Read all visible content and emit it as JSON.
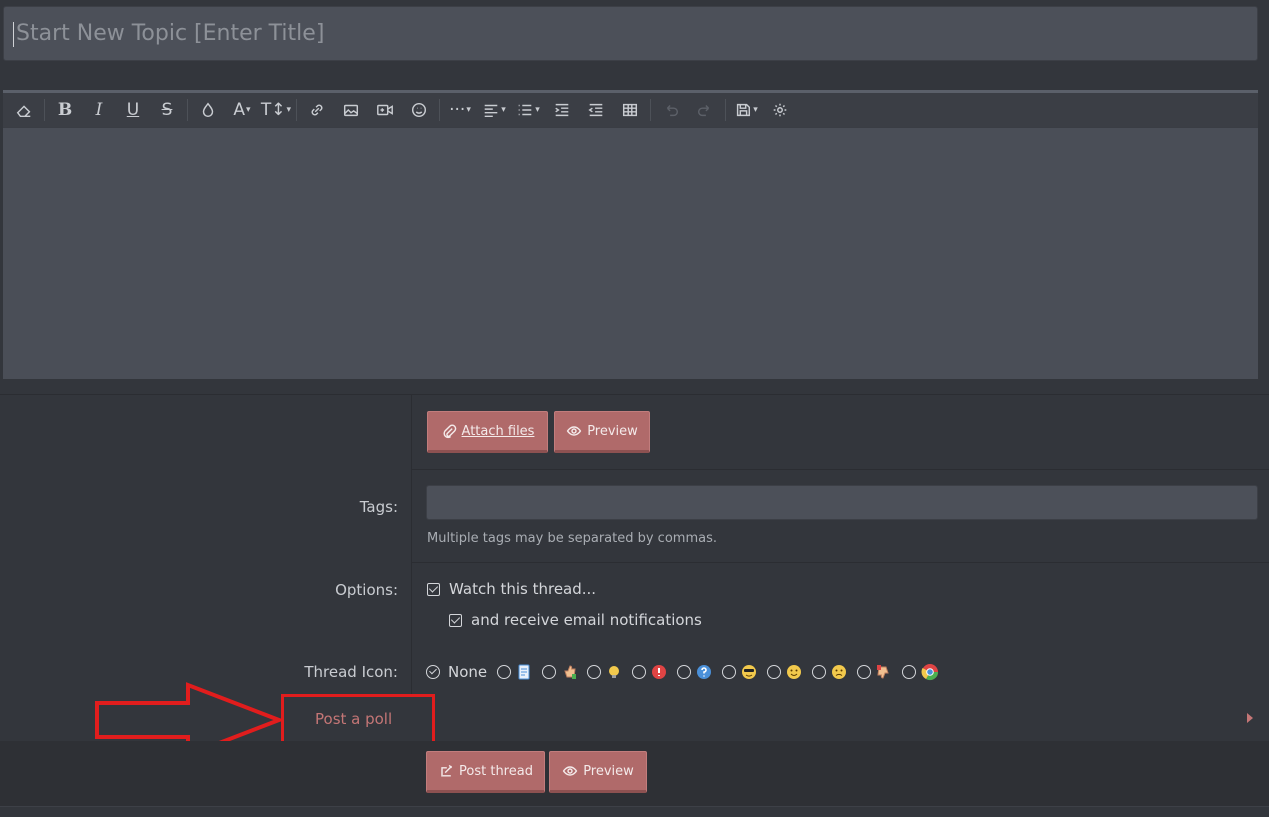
{
  "title_field": {
    "placeholder": "Start New Topic [Enter Title]",
    "value": ""
  },
  "toolbar": {
    "buttons": [
      "eraser-icon",
      "bold-icon",
      "italic-icon",
      "underline-icon",
      "strikethrough-icon",
      "color-icon",
      "font-size-icon",
      "text-size-icon",
      "link-icon",
      "image-icon",
      "video-icon",
      "emoji-icon",
      "more-icon",
      "align-icon",
      "list-icon",
      "indent-icon",
      "outdent-icon",
      "table-icon",
      "undo-icon",
      "redo-icon",
      "drafts-icon",
      "settings-icon"
    ]
  },
  "attach_button": {
    "label": "Attach files"
  },
  "preview_button": {
    "label": "Preview"
  },
  "tags": {
    "label": "Tags:",
    "value": "",
    "hint": "Multiple tags may be separated by commas."
  },
  "options": {
    "label": "Options:",
    "watch_thread": "Watch this thread...",
    "email_notifications": "and receive email notifications"
  },
  "thread_icon": {
    "label": "Thread Icon:",
    "none_label": "None",
    "icons": [
      {
        "name": "document-icon",
        "color": "#4a90d9"
      },
      {
        "name": "thumbs-up-icon",
        "color": "#f0c090"
      },
      {
        "name": "lightbulb-icon",
        "color": "#f2c94c"
      },
      {
        "name": "exclamation-icon",
        "color": "#e04444"
      },
      {
        "name": "question-icon",
        "color": "#4a90d9"
      },
      {
        "name": "cool-face-icon",
        "color": "#f2c94c"
      },
      {
        "name": "smile-face-icon",
        "color": "#f2c94c"
      },
      {
        "name": "sad-face-icon",
        "color": "#f2c94c"
      },
      {
        "name": "thumbs-down-icon",
        "color": "#f0c090"
      },
      {
        "name": "chrome-icon",
        "color": "#e04444"
      }
    ]
  },
  "poll": {
    "label": "Post a poll"
  },
  "post_thread_button": {
    "label": "Post thread"
  },
  "preview_button_bottom": {
    "label": "Preview"
  },
  "colors": {
    "accent": "#b06a6a",
    "annotation": "#e11d1d",
    "background": "#33363c",
    "input": "#4c5059"
  }
}
